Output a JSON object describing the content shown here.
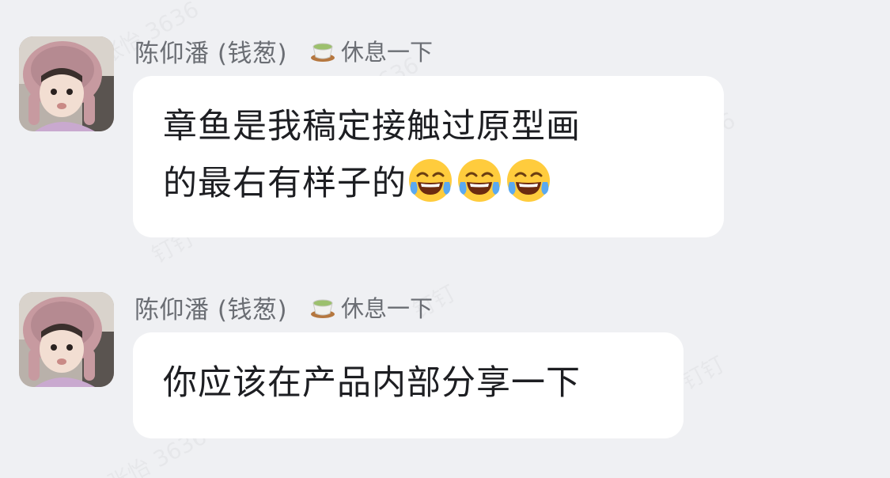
{
  "messages": [
    {
      "sender": "陈仰潘 (钱葱)",
      "status": "休息一下",
      "status_icon": "tea-cup-icon",
      "text_line1": "章鱼是我稿定接触过原型画",
      "text_line2": "的最右有样子的",
      "emojis": [
        "tears-of-joy-emoji",
        "tears-of-joy-emoji",
        "tears-of-joy-emoji"
      ]
    },
    {
      "sender": "陈仰潘 (钱葱)",
      "status": "休息一下",
      "status_icon": "tea-cup-icon",
      "text": "你应该在产品内部分享一下"
    }
  ],
  "watermark": "张怡 3636 钉钉",
  "colors": {
    "background": "#eff0f3",
    "bubble": "#ffffff",
    "meta_text": "#6b6e74",
    "message_text": "#1d1e22"
  }
}
